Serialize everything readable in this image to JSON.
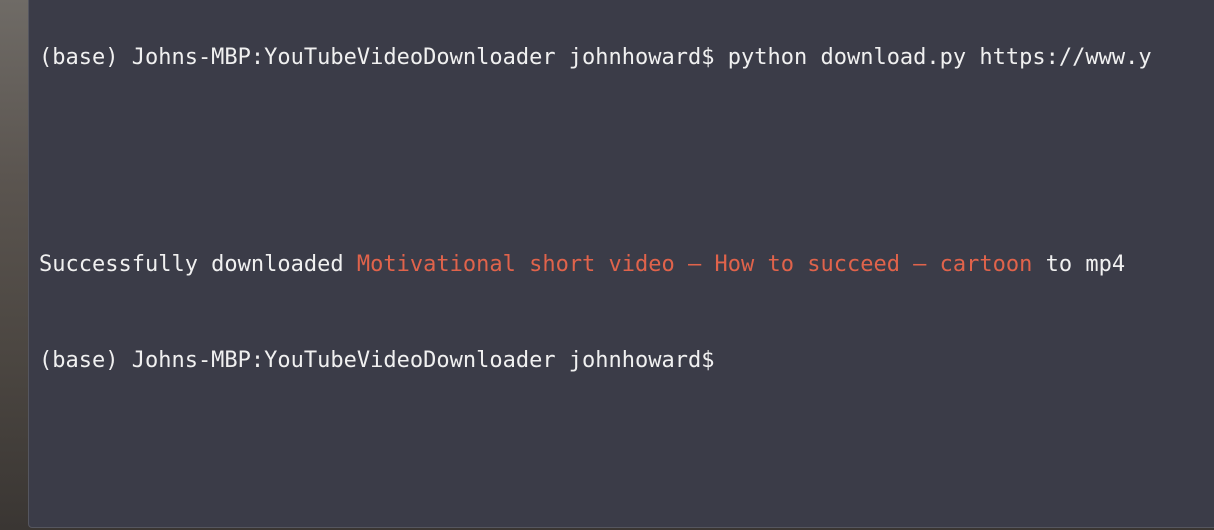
{
  "terminal": {
    "lines": {
      "command": "(base) Johns-MBP:YouTubeVideoDownloader johnhoward$ python download.py https://www.y",
      "blank": "",
      "success_prefix": "Successfully downloaded ",
      "success_filename": "Motivational short video – How to succeed – cartoon",
      "success_suffix": " to mp4",
      "prompt": "(base) Johns-MBP:YouTubeVideoDownloader johnhoward$"
    }
  },
  "colors": {
    "terminal_background": "#3b3c48",
    "text": "#f0f0f0",
    "filename_highlight": "#e0634b"
  }
}
